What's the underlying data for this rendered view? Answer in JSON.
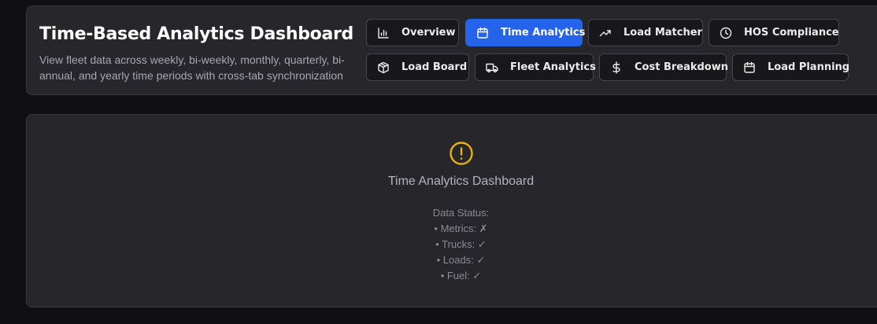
{
  "header": {
    "title": "Time-Based Analytics Dashboard",
    "subtitle": "View fleet data across weekly, bi-weekly, monthly, quarterly, bi-annual, and yearly time periods with cross-tab synchronization"
  },
  "nav": {
    "overview": "Overview",
    "time_analytics": "Time Analytics",
    "load_matcher": "Load Matcher",
    "hos_compliance": "HOS Compliance",
    "load_board": "Load Board",
    "fleet_analytics": "Fleet Analytics",
    "cost_breakdown": "Cost Breakdown",
    "load_planning": "Load Planning",
    "active": "Time Analytics"
  },
  "main": {
    "icon": "alert-circle-icon",
    "title": "Time Analytics Dashboard",
    "status_heading": "Data Status:",
    "status_metrics": "• Metrics: ✗",
    "status_trucks": "• Trucks: ✓",
    "status_loads": "• Loads: ✓",
    "status_fuel": "• Fuel: ✓"
  },
  "colors": {
    "accent": "#2563eb",
    "warning": "#eab308",
    "background": "#101013",
    "card": "#26262b"
  }
}
